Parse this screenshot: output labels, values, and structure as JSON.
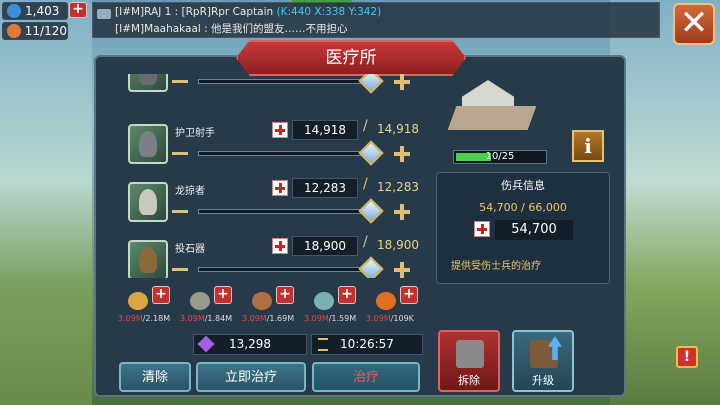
{
  "resources_top": {
    "gold": "1,403",
    "troops": "11/120"
  },
  "chat": {
    "line1_prefix": "[I#M]RAJ 1 : [RpR]Rpr Captain",
    "line1_coord": "(K:440 X:338 Y:342)",
    "line2": "[I#M]Maahakaal : 他是我们的盟友……不用担心"
  },
  "title": "医疗所",
  "units": [
    {
      "name": "",
      "current": "",
      "max": ""
    },
    {
      "name": "护卫射手",
      "current": "14,918",
      "max": "14,918"
    },
    {
      "name": "龙掠者",
      "current": "12,283",
      "max": "12,283"
    },
    {
      "name": "投石器",
      "current": "18,900",
      "max": "18,900"
    }
  ],
  "costs": [
    {
      "icon": "wheat-icon",
      "needed": "3.09M",
      "have": "/2.18M",
      "color": "#d9a640"
    },
    {
      "icon": "stone-icon",
      "needed": "3.09M",
      "have": "/1.84M",
      "color": "#9a9a8a"
    },
    {
      "icon": "wood-icon",
      "needed": "3.09M",
      "have": "/1.69M",
      "color": "#b07040"
    },
    {
      "icon": "ore-icon",
      "needed": "3.09M",
      "have": "/1.59M",
      "color": "#7ab0b0"
    },
    {
      "icon": "gold-icon",
      "needed": "3.09M",
      "have": "/109K",
      "color": "#e07020"
    }
  ],
  "gems": "13,298",
  "time": "10:26:57",
  "buttons": {
    "clear": "清除",
    "heal_now": "立即治疗",
    "heal": "治疗",
    "dismiss": "拆除",
    "upgrade": "升级"
  },
  "building": {
    "level": "10/25",
    "level_fraction": 0.4
  },
  "injury": {
    "header": "伤兵信息",
    "ratio": "54,700 / 66,000",
    "count": "54,700",
    "desc": "提供受伤士兵的治疗"
  },
  "colors": {
    "accent_red": "#c23030",
    "panel": "#263a4a",
    "gold_text": "#f0c860"
  }
}
